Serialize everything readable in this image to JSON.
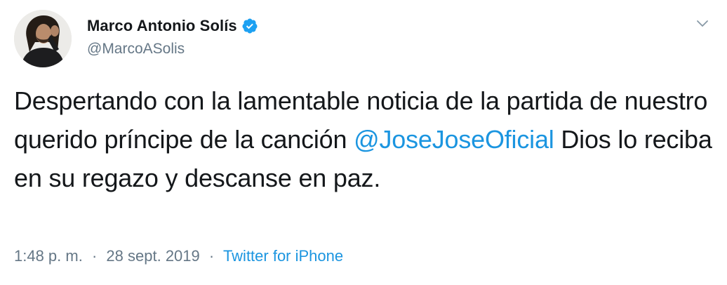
{
  "author": {
    "display_name": "Marco Antonio Solís",
    "handle": "@MarcoASolis",
    "verified": true
  },
  "tweet": {
    "text_part1": "Despertando con la lamentable noticia de la partida de nuestro querido príncipe de la canción ",
    "mention": "@JoseJoseOficial",
    "text_part2": " Dios lo reciba en su regazo y descanse en paz."
  },
  "meta": {
    "time": "1:48 p. m.",
    "separator": "·",
    "date": "28 sept. 2019",
    "source": "Twitter for iPhone"
  },
  "colors": {
    "link": "#1b95e0",
    "secondary_text": "#657786",
    "primary_text": "#14171a"
  },
  "icons": {
    "verified": "verified-badge-icon",
    "menu": "chevron-down-icon"
  }
}
